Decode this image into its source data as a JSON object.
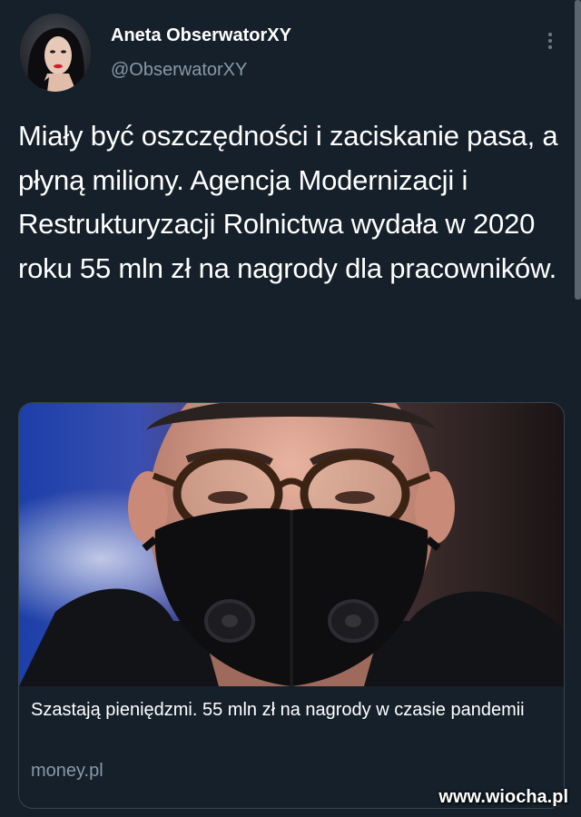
{
  "author": {
    "name": "Aneta ObserwatorXY",
    "handle": "@ObserwatorXY",
    "avatar": "avatar-photo"
  },
  "tweet": {
    "text": "Miały być oszczędności i zaciskanie pasa, a płyną miliony. Agencja Modernizacji i Restrukturyzacji Rolnictwa wydała w 2020 roku 55 mln zł na nagrody dla pracowników."
  },
  "card": {
    "image": "man-with-glasses-and-black-face-mask",
    "title": "Szastają pieniędzmi. 55 mln zł na nagrody w czasie pandemii",
    "domain": "money.pl"
  },
  "menu": {
    "icon": "more-vertical-icon"
  },
  "watermark": {
    "text": "www.wiocha.pl"
  },
  "colors": {
    "background": "#15202b",
    "text": "#ffffff",
    "secondary_text": "#8899a6",
    "border": "#38444d"
  }
}
